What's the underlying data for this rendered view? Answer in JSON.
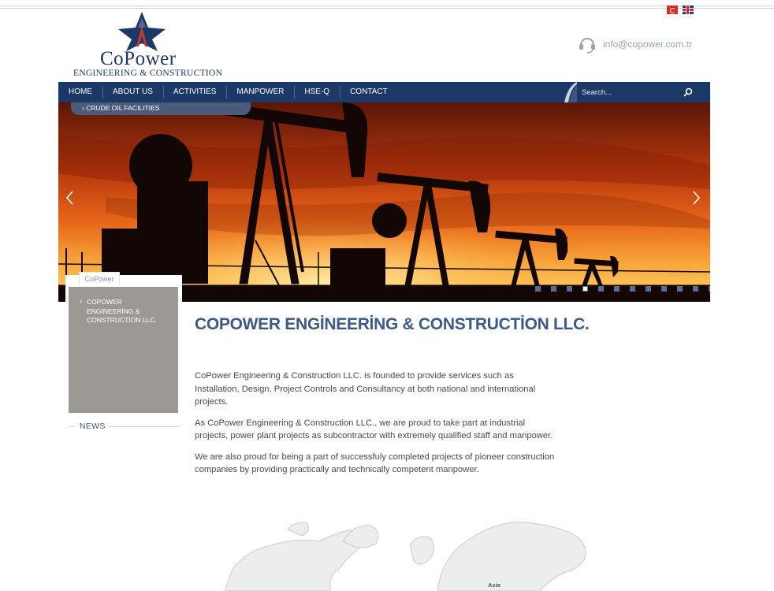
{
  "header": {
    "logo_name": "CoPower",
    "logo_sub": "ENGINEERING & CONSTRUCTION",
    "email": "info@copower.com.tr",
    "languages": [
      "tr-flag-icon",
      "en-flag-icon"
    ]
  },
  "nav": {
    "items": [
      {
        "label": "HOME"
      },
      {
        "label": "ABOUT US"
      },
      {
        "label": "ACTIVITIES"
      },
      {
        "label": "MANPOWER"
      },
      {
        "label": "HSE-Q"
      },
      {
        "label": "CONTACT"
      }
    ],
    "search_placeholder": "Search..."
  },
  "hero": {
    "caption": "CRUDE OIL FACILITIES",
    "slide_count": 12,
    "active_slide": 4
  },
  "sidebar": {
    "tab_label": "CoPower",
    "link": "COPOWER ENGİNEERİNG & CONSTRUCTİON LLC.",
    "news_label": "NEWS"
  },
  "main": {
    "title": "COPOWER ENGİNEERİNG & CONSTRUCTİON LLC.",
    "paragraphs": [
      "CoPower Engineering & Construction LLC. is founded to provide services such as Installation, Design, Project Controls and Consultancy at both national and international projects.",
      "As CoPower Engineering & Construction LLC., we are proud to take part at industrial projects, power plant projects as subcontractor with extremely qualified staff and manpower.",
      "We are also proud for being a part of successfuly completed projects of pioneer construction companies by providing practically and technically competent manpower."
    ],
    "map_label": "Asia"
  },
  "colors": {
    "brand_navy": "#1c3866",
    "title_blue": "#3c5a86",
    "sidebar_gray": "#9c9893"
  }
}
